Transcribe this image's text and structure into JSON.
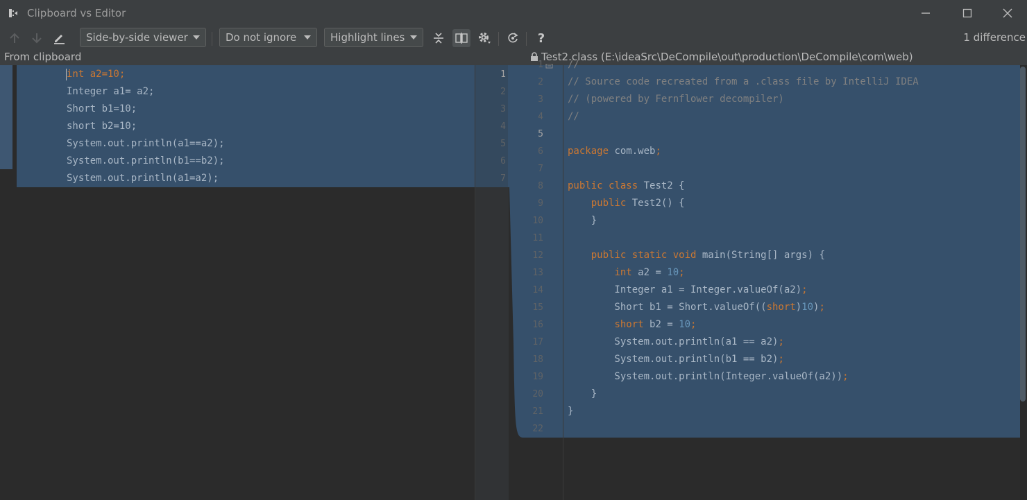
{
  "window": {
    "title": "Clipboard vs Editor"
  },
  "toolbar": {
    "viewer_mode": "Side-by-side viewer",
    "ignore_mode": "Do not ignore",
    "highlight_mode": "Highlight lines",
    "help_label": "?",
    "diff_count": "1 difference"
  },
  "left_panel": {
    "header": "From clipboard",
    "lines": [
      "int a2=10;",
      "Integer a1= a2;",
      "Short b1=10;",
      "short b2=10;",
      "System.out.println(a1==a2);",
      "System.out.println(b1==b2);",
      "System.out.println(a1=a2);"
    ],
    "line_numbers": [
      "1",
      "2",
      "3",
      "4",
      "5",
      "6",
      "7"
    ]
  },
  "right_panel": {
    "header": "Test2.class (E:\\ideaSrc\\DeCompile\\out\\production\\DeCompile\\com\\web)",
    "lines": [
      "//",
      "// Source code recreated from a .class file by IntelliJ IDEA",
      "// (powered by Fernflower decompiler)",
      "//",
      "",
      "package com.web;",
      "",
      "public class Test2 {",
      "    public Test2() {",
      "    }",
      "",
      "    public static void main(String[] args) {",
      "        int a2 = 10;",
      "        Integer a1 = Integer.valueOf(a2);",
      "        Short b1 = Short.valueOf((short)10);",
      "        short b2 = 10;",
      "        System.out.println(a1 == a2);",
      "        System.out.println(b1 == b2);",
      "        System.out.println(Integer.valueOf(a2));",
      "    }",
      "}",
      ""
    ],
    "line_numbers": [
      "1",
      "2",
      "3",
      "4",
      "5",
      "6",
      "7",
      "8",
      "9",
      "10",
      "11",
      "12",
      "13",
      "14",
      "15",
      "16",
      "17",
      "18",
      "19",
      "20",
      "21",
      "22"
    ]
  },
  "colors": {
    "background": "#2b2b2b",
    "toolbar": "#3c3f41",
    "diff_highlight": "#36506b",
    "keyword": "#cc7832",
    "number": "#6897bb",
    "comment": "#808080",
    "text": "#a9b7c6"
  },
  "icons": [
    "app-icon",
    "minimize-icon",
    "maximize-icon",
    "close-icon",
    "arrow-up-icon",
    "arrow-down-icon",
    "edit-icon",
    "collapse-icon",
    "sync-scroll-icon",
    "gear-icon",
    "refresh-icon",
    "lock-icon"
  ]
}
